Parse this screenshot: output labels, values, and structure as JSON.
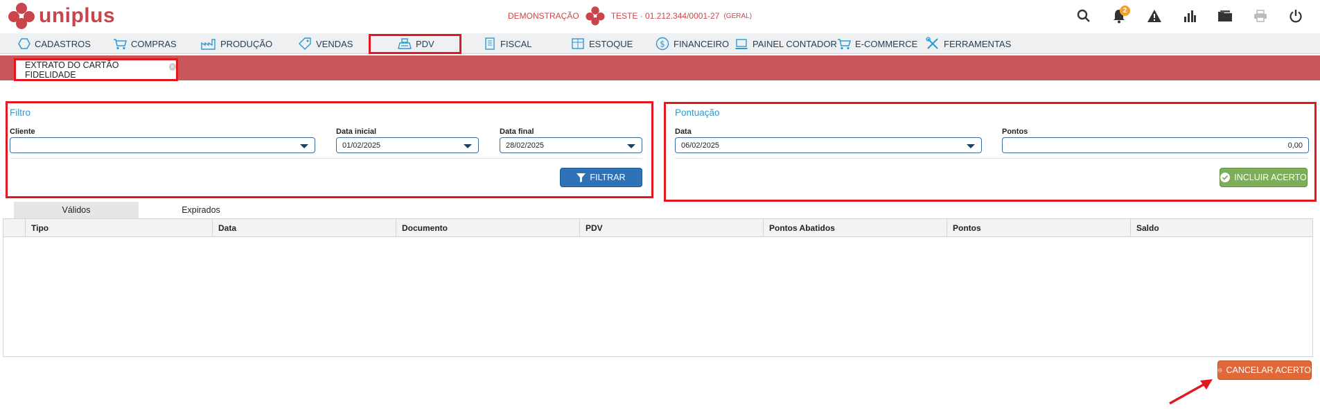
{
  "brand": {
    "name": "uniplus",
    "color": "#c9454b"
  },
  "company": {
    "name": "DEMONSTRAÇÃO",
    "detail": "TESTE · 01.212.344/0001-27",
    "scope": "(GERAL)"
  },
  "top_icons": [
    {
      "name": "search-icon"
    },
    {
      "name": "bell-icon",
      "badge": "2"
    },
    {
      "name": "alert-icon"
    },
    {
      "name": "chart-icon"
    },
    {
      "name": "folder-icon"
    },
    {
      "name": "printer-icon"
    },
    {
      "name": "power-icon"
    }
  ],
  "menu": [
    {
      "label": "CADASTROS",
      "icon": "hexagon-icon"
    },
    {
      "label": "COMPRAS",
      "icon": "cart-icon"
    },
    {
      "label": "PRODUÇÃO",
      "icon": "factory-icon"
    },
    {
      "label": "VENDAS",
      "icon": "tag-icon"
    },
    {
      "label": "PDV",
      "icon": "register-icon"
    },
    {
      "label": "FISCAL",
      "icon": "document-icon"
    },
    {
      "label": "ESTOQUE",
      "icon": "box-icon"
    },
    {
      "label": "FINANCEIRO",
      "icon": "dollar-icon"
    },
    {
      "label": "PAINEL CONTADOR",
      "icon": "laptop-icon"
    },
    {
      "label": "E-COMMERCE",
      "icon": "cart-icon"
    },
    {
      "label": "FERRAMENTAS",
      "icon": "tools-icon"
    }
  ],
  "active_tab": {
    "label": "EXTRATO DO CARTÃO FIDELIDADE"
  },
  "filtro": {
    "title": "Filtro",
    "cliente_label": "Cliente",
    "cliente_value": "",
    "data_inicial_label": "Data inicial",
    "data_inicial_value": "01/02/2025",
    "data_final_label": "Data final",
    "data_final_value": "28/02/2025",
    "button": "FILTRAR"
  },
  "pontuacao": {
    "title": "Pontuação",
    "data_label": "Data",
    "data_value": "06/02/2025",
    "pontos_label": "Pontos",
    "pontos_value": "0,00",
    "button": "INCLUIR ACERTO"
  },
  "subtabs": [
    "Válidos",
    "Expirados"
  ],
  "table": {
    "columns": [
      "Tipo",
      "Data",
      "Documento",
      "PDV",
      "Pontos Abatidos",
      "Pontos",
      "Saldo"
    ],
    "rows": []
  },
  "cancel_button": "CANCELAR ACERTO",
  "colors": {
    "accent": "#c8565a",
    "highlight": "#e1191f",
    "link": "#2a9ad6",
    "primary": "#2f72b8",
    "success": "#7dae59",
    "danger": "#e0683a"
  }
}
